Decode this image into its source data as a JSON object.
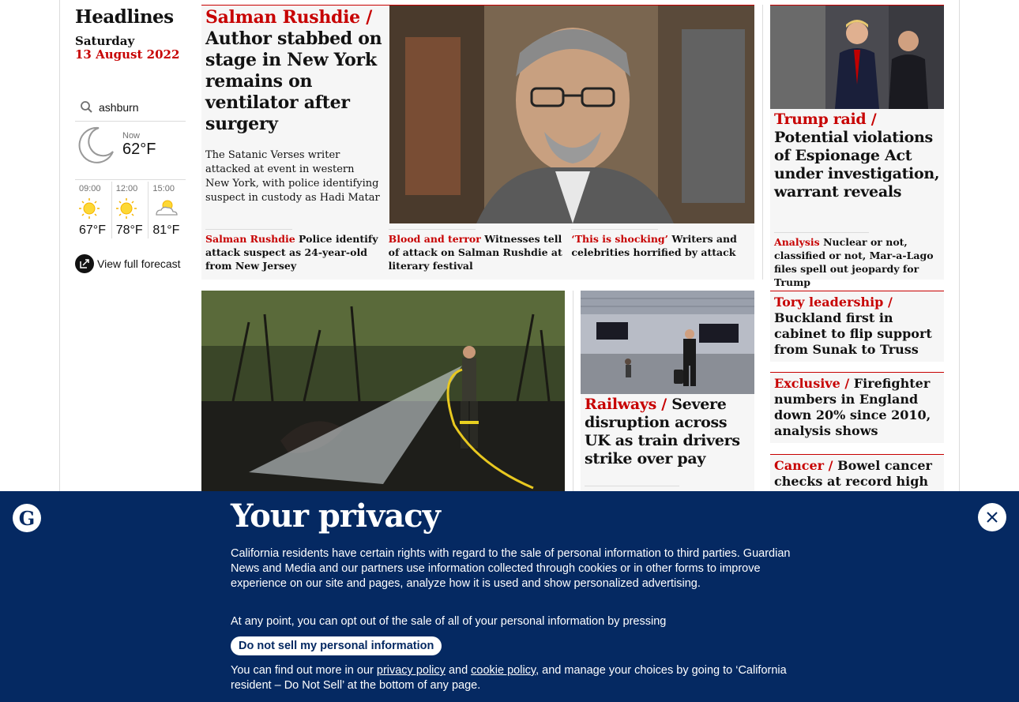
{
  "sidebar": {
    "title": "Headlines",
    "day": "Saturday",
    "date": "13 August 2022",
    "search_value": "ashburn",
    "now_label": "Now",
    "now_temp": "62°F",
    "forecast": [
      {
        "time": "09:00",
        "temp": "67°F",
        "icon": "sun-icon"
      },
      {
        "time": "12:00",
        "temp": "78°F",
        "icon": "sun-icon"
      },
      {
        "time": "15:00",
        "temp": "81°F",
        "icon": "partly-cloudy-icon"
      }
    ],
    "full_forecast_label": "View full forecast"
  },
  "top_story": {
    "kicker": "Salman Rushdie /",
    "headline": "Author stabbed on stage in New York remains on ventilator after surgery",
    "standfirst": "The Satanic Verses writer attacked at event in western New York, with police identifying suspect in custody as Hadi Matar",
    "sublinks": [
      {
        "kicker": "Salman Rushdie",
        "text": "Police identify attack suspect as 24-year-old from New Jersey"
      },
      {
        "kicker": "Blood and terror",
        "text": "Witnesses tell of attack on Salman Rushdie at literary festival"
      },
      {
        "kicker": "‘This is shocking’",
        "text": "Writers and celebrities horrified by attack"
      }
    ]
  },
  "trump_story": {
    "kicker": "Trump raid /",
    "headline": "Potential violations of Espionage Act under investigation, warrant reveals",
    "sub_kicker": "Analysis",
    "sub_text": "Nuclear or not, classified or not, Mar-a-Lago files spell out jeopardy for Trump"
  },
  "rail_story": {
    "kicker": "Railways /",
    "headline": "Severe disruption across UK as train drivers strike over pay"
  },
  "small_stories": [
    {
      "kicker": "Tory leadership /",
      "headline": "Buckland first in cabinet to flip support from Sunak to Truss"
    },
    {
      "kicker": "Exclusive /",
      "headline": "Firefighter numbers in England down 20% since 2010, analysis shows"
    },
    {
      "kicker": "Cancer /",
      "headline": "Bowel cancer checks at record high after Deborah James death"
    }
  ],
  "privacy": {
    "title": "Your privacy",
    "para1": "California residents have certain rights with regard to the sale of personal information to third parties. Guardian News and Media and our partners use information collected through cookies or in other forms to improve experience on our site and pages, analyze how it is used and show personalized advertising.",
    "para2": "At any point, you can opt out of the sale of all of your personal information by pressing",
    "button": "Do not sell my personal information",
    "para3_a": "You can find out more in our",
    "privacy_link": "privacy policy",
    "and": "and",
    "cookie_link": "cookie policy",
    "para3_b": ", and manage your choices by going to ‘California resident – Do Not Sell’ at the bottom of any page."
  },
  "colors": {
    "accent": "#c70000",
    "banner": "#052962",
    "card_bg": "#f6f6f6"
  }
}
